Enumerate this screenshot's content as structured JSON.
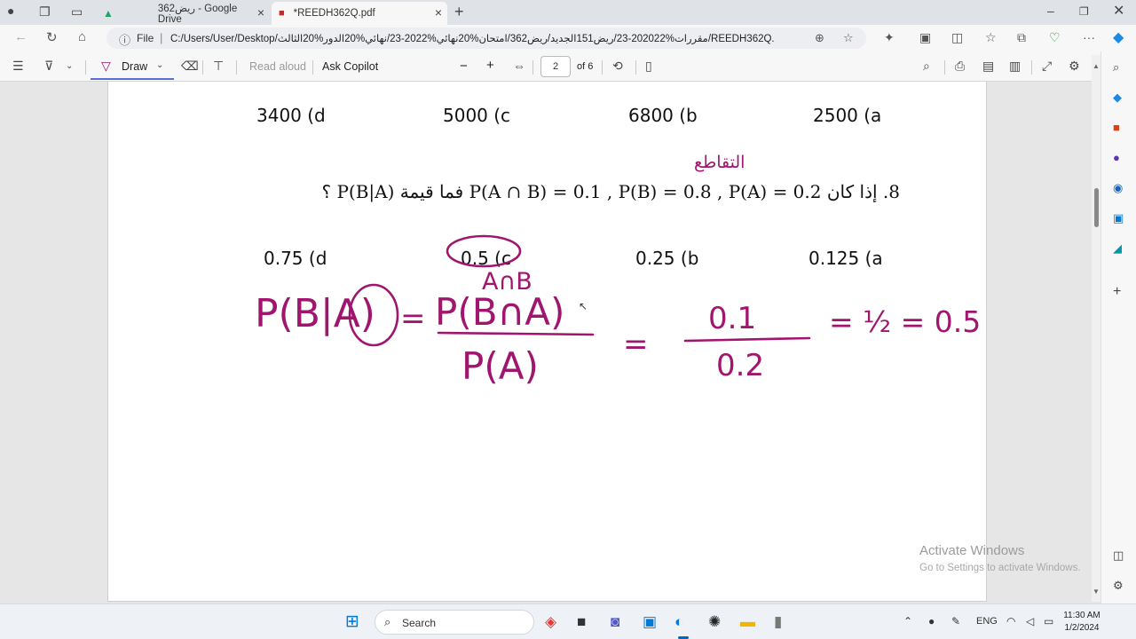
{
  "browser": {
    "tabs": [
      {
        "title": "ريض362 - Google Drive",
        "icon": "google-drive-icon"
      },
      {
        "title": "*REEDH362Q.pdf",
        "icon": "pdf-icon"
      }
    ],
    "new_tab_label": "+",
    "address": {
      "scheme": "File",
      "url": "C:/Users/User/Desktop/مقررات%202022-23/ريض151الجديد/ريض362/امتحان%20نهائي%2022-23/نهائي%20الدور%20الثالث/REEDH362Q.pdf"
    }
  },
  "pdf_toolbar": {
    "draw_label": "Draw",
    "read_aloud_label": "Read aloud",
    "ask_copilot_label": "Ask Copilot",
    "zoom_out": "−",
    "zoom_in": "+",
    "page_current": "2",
    "page_total": "of 6"
  },
  "document": {
    "row1_options": [
      "3400 (d",
      "5000 (c",
      "6800 (b",
      "2500 (a"
    ],
    "question_8": "8. إذا كان P(A ∩ B) = 0.1 , P(B) = 0.8 , P(A) = 0.2 فما قيمة P(B|A) ؟",
    "row2_options": [
      "0.75 (d",
      "0.5 (c",
      "0.25 (b",
      "0.125 (a"
    ]
  },
  "handwriting": {
    "annotation_word": "التقاطع",
    "above_answer": "A∩B",
    "lhs": "P(B|A)",
    "equals": "=",
    "numerator": "P(B∩A)",
    "denominator": "P(A)",
    "frac_num": "0.1",
    "frac_den": "0.2",
    "result": "= ½ = 0.5",
    "ink_color": "#a0166e"
  },
  "watermark": {
    "line1": "Activate Windows",
    "line2": "Go to Settings to activate Windows."
  },
  "taskbar": {
    "search_label": "Search",
    "language": "ENG",
    "time": "11:30 AM",
    "date": "1/2/2024"
  }
}
